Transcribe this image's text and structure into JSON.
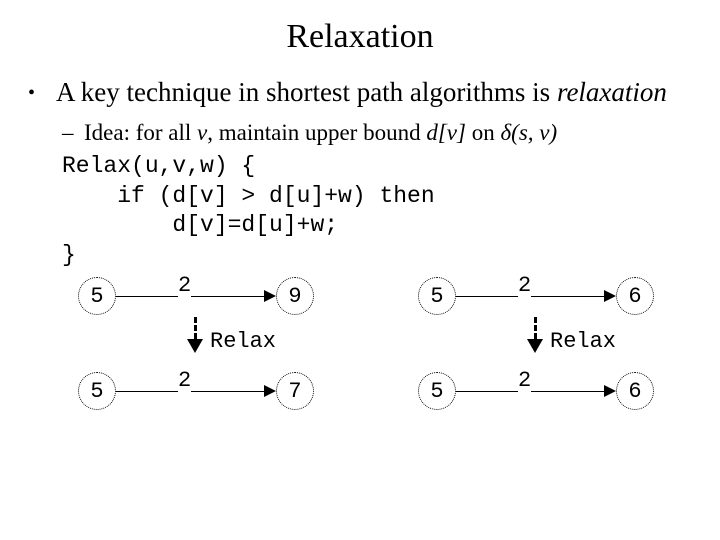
{
  "title": "Relaxation",
  "bullet": {
    "prefix": "A key technique in shortest path algorithms is ",
    "italic": "relaxation"
  },
  "sub": {
    "p1": "Idea: for all ",
    "v1": "v",
    "p2": ", maintain upper bound ",
    "v2": "d[v]",
    "p3": " on ",
    "v3": "δ(s, v)"
  },
  "code": {
    "l1": "Relax(u,v,w) {",
    "l2": "    if (d[v] > d[u]+w) then",
    "l3": "        d[v]=d[u]+w;",
    "l4": "}"
  },
  "diagram": {
    "topLeft": {
      "u": "5",
      "w": "2",
      "v": "9"
    },
    "topRight": {
      "u": "5",
      "w": "2",
      "v": "6"
    },
    "botLeft": {
      "u": "5",
      "w": "2",
      "v": "7"
    },
    "botRight": {
      "u": "5",
      "w": "2",
      "v": "6"
    },
    "relax": "Relax"
  }
}
